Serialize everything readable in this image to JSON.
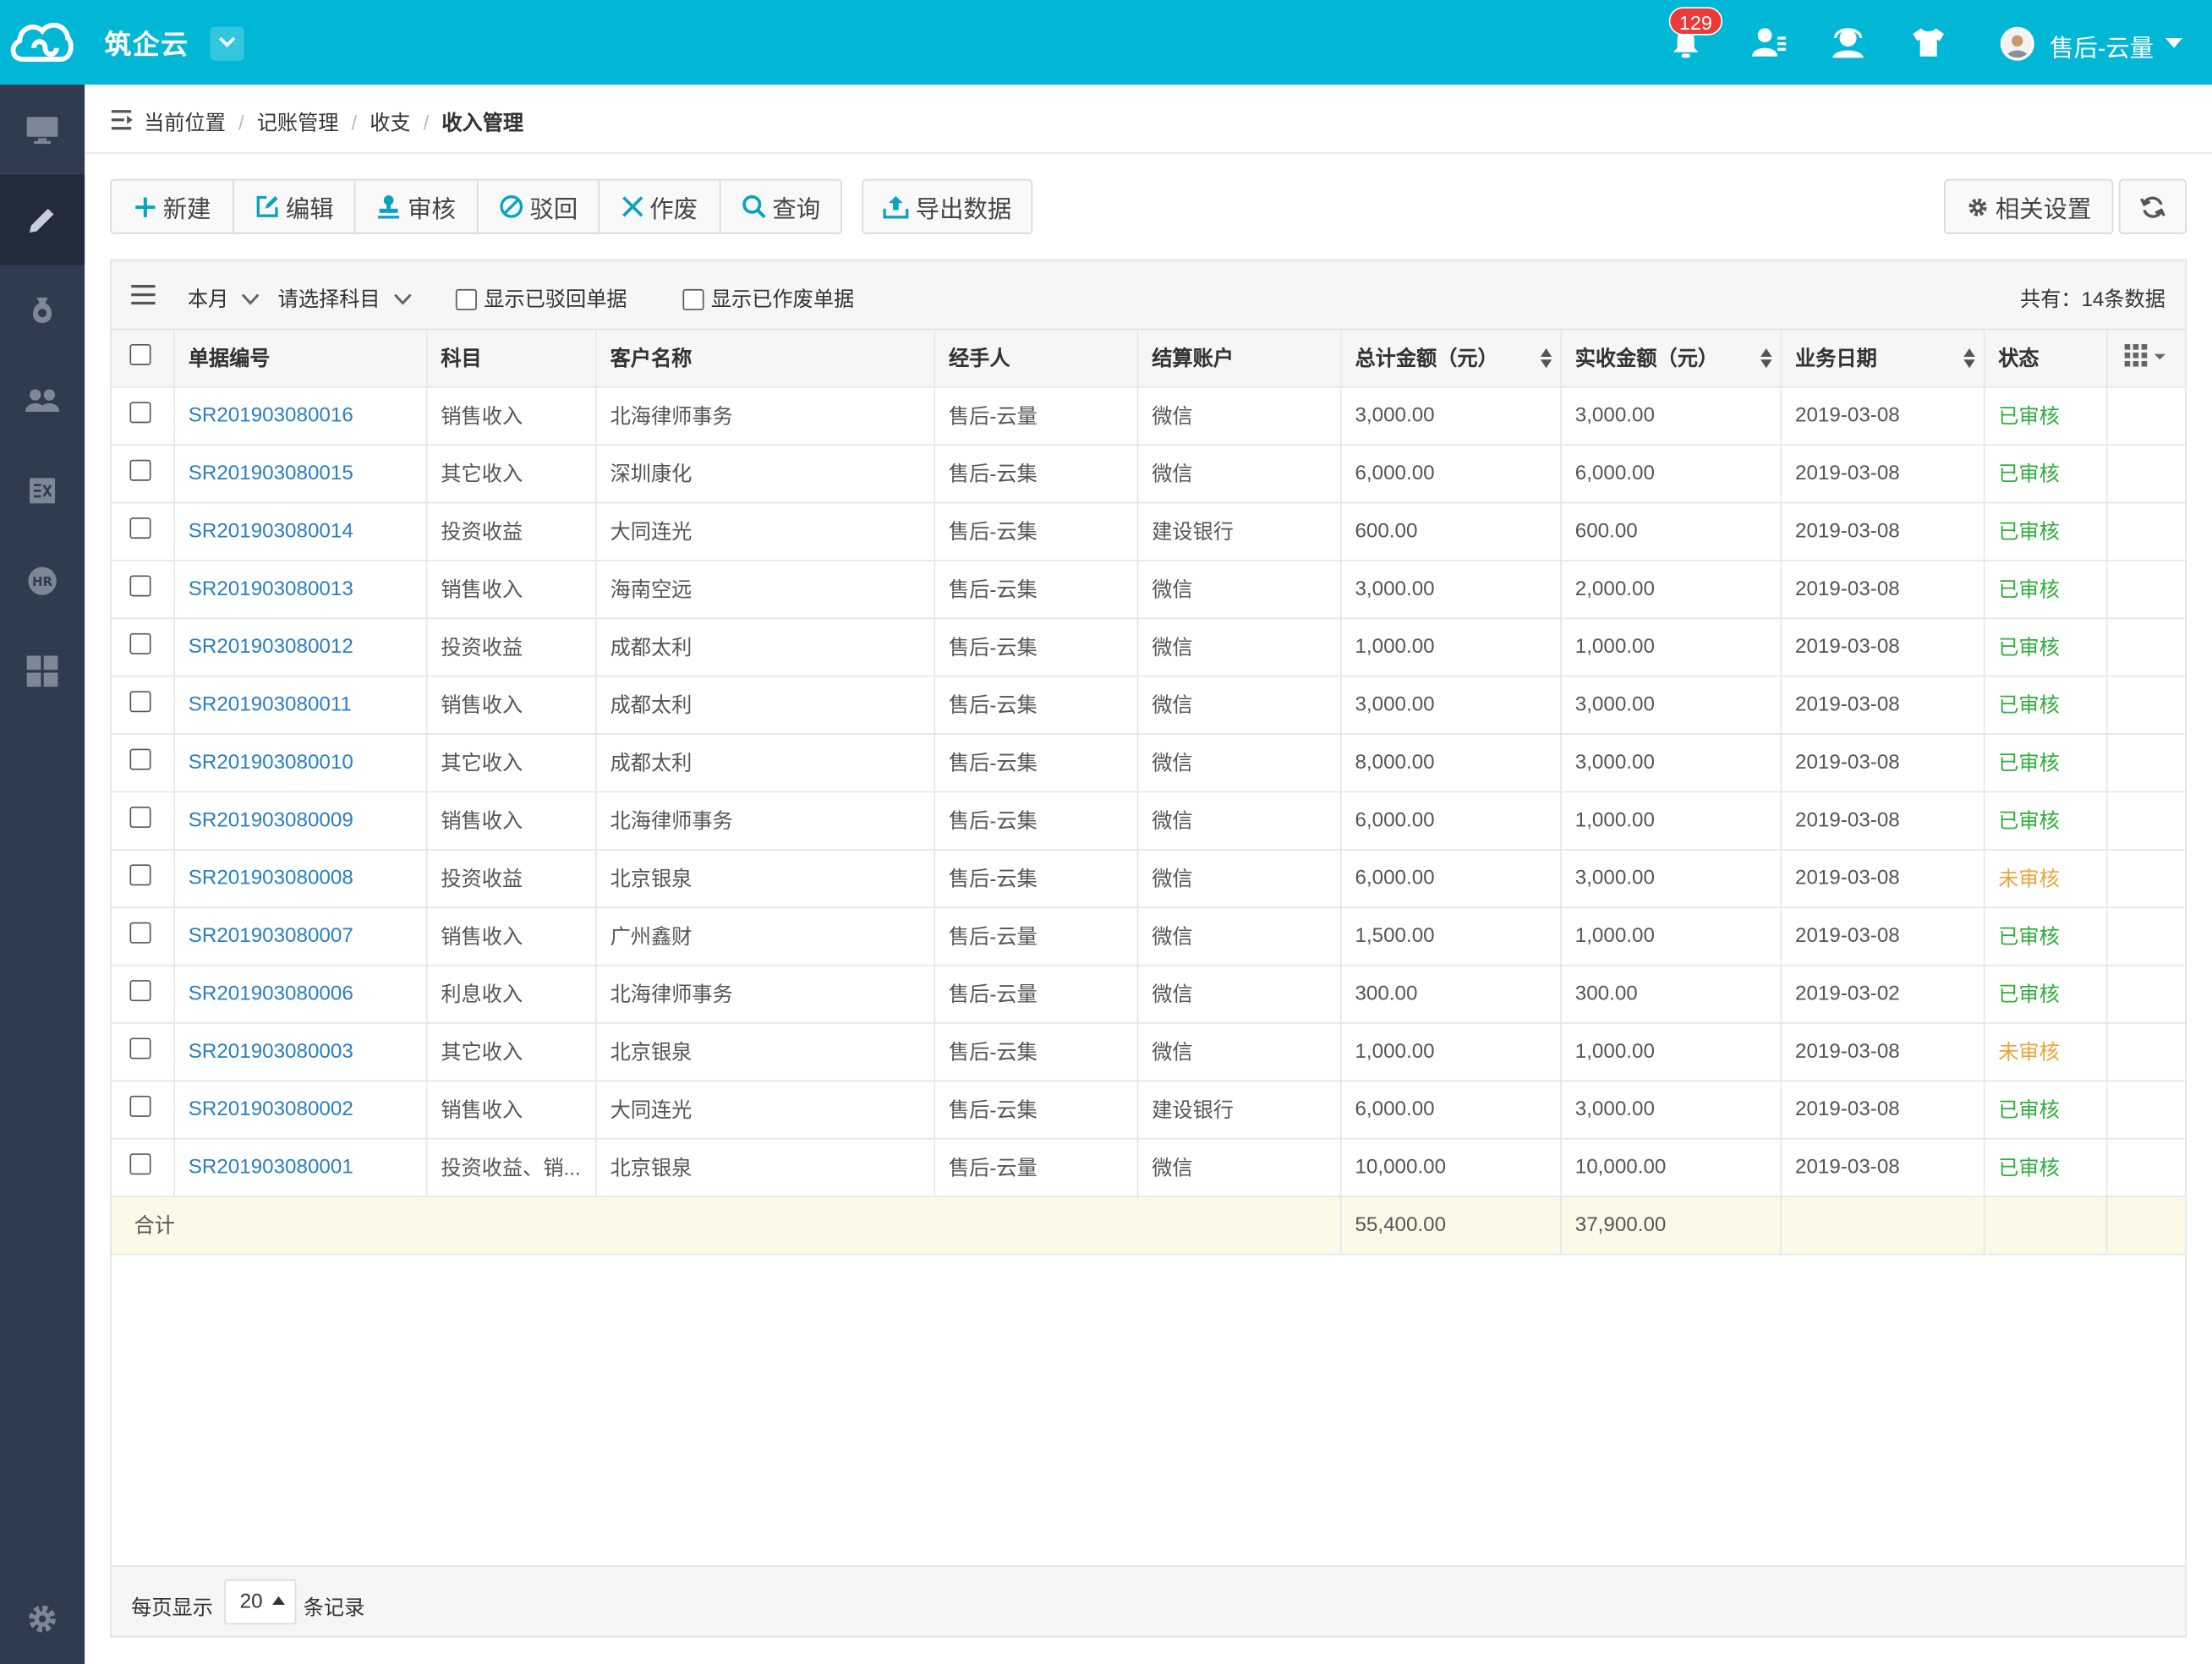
{
  "app": {
    "name": "筑企云"
  },
  "header": {
    "notification_count": "129",
    "user_name": "售后-云量"
  },
  "breadcrumb": {
    "items": [
      "当前位置",
      "记账管理",
      "收支",
      "收入管理"
    ]
  },
  "toolbar": {
    "new_label": "新建",
    "edit_label": "编辑",
    "audit_label": "审核",
    "reject_label": "驳回",
    "void_label": "作废",
    "query_label": "查询",
    "export_label": "导出数据",
    "settings_label": "相关设置"
  },
  "filters": {
    "period": "本月",
    "subject_placeholder": "请选择科目",
    "show_rejected": "显示已驳回单据",
    "show_voided": "显示已作废单据",
    "total_count": "共有：14条数据"
  },
  "table": {
    "columns": [
      "单据编号",
      "科目",
      "客户名称",
      "经手人",
      "结算账户",
      "总计金额（元）",
      "实收金额（元）",
      "业务日期",
      "状态"
    ],
    "rows": [
      [
        "SR201903080016",
        "销售收入",
        "北海律师事务",
        "售后-云量",
        "微信",
        "3,000.00",
        "3,000.00",
        "2019-03-08",
        "已审核"
      ],
      [
        "SR201903080015",
        "其它收入",
        "深圳康化",
        "售后-云集",
        "微信",
        "6,000.00",
        "6,000.00",
        "2019-03-08",
        "已审核"
      ],
      [
        "SR201903080014",
        "投资收益",
        "大同连光",
        "售后-云集",
        "建设银行",
        "600.00",
        "600.00",
        "2019-03-08",
        "已审核"
      ],
      [
        "SR201903080013",
        "销售收入",
        "海南空远",
        "售后-云集",
        "微信",
        "3,000.00",
        "2,000.00",
        "2019-03-08",
        "已审核"
      ],
      [
        "SR201903080012",
        "投资收益",
        "成都太利",
        "售后-云集",
        "微信",
        "1,000.00",
        "1,000.00",
        "2019-03-08",
        "已审核"
      ],
      [
        "SR201903080011",
        "销售收入",
        "成都太利",
        "售后-云集",
        "微信",
        "3,000.00",
        "3,000.00",
        "2019-03-08",
        "已审核"
      ],
      [
        "SR201903080010",
        "其它收入",
        "成都太利",
        "售后-云集",
        "微信",
        "8,000.00",
        "3,000.00",
        "2019-03-08",
        "已审核"
      ],
      [
        "SR201903080009",
        "销售收入",
        "北海律师事务",
        "售后-云集",
        "微信",
        "6,000.00",
        "1,000.00",
        "2019-03-08",
        "已审核"
      ],
      [
        "SR201903080008",
        "投资收益",
        "北京银泉",
        "售后-云集",
        "微信",
        "6,000.00",
        "3,000.00",
        "2019-03-08",
        "未审核"
      ],
      [
        "SR201903080007",
        "销售收入",
        "广州鑫财",
        "售后-云量",
        "微信",
        "1,500.00",
        "1,000.00",
        "2019-03-08",
        "已审核"
      ],
      [
        "SR201903080006",
        "利息收入",
        "北海律师事务",
        "售后-云量",
        "微信",
        "300.00",
        "300.00",
        "2019-03-02",
        "已审核"
      ],
      [
        "SR201903080003",
        "其它收入",
        "北京银泉",
        "售后-云集",
        "微信",
        "1,000.00",
        "1,000.00",
        "2019-03-08",
        "未审核"
      ],
      [
        "SR201903080002",
        "销售收入",
        "大同连光",
        "售后-云集",
        "建设银行",
        "6,000.00",
        "3,000.00",
        "2019-03-08",
        "已审核"
      ],
      [
        "SR201903080001",
        "投资收益、销...",
        "北京银泉",
        "售后-云量",
        "微信",
        "10,000.00",
        "10,000.00",
        "2019-03-08",
        "已审核"
      ]
    ],
    "total": {
      "label": "合计",
      "total_amount": "55,400.00",
      "received_amount": "37,900.00"
    }
  },
  "pagination": {
    "per_page_label": "每页显示",
    "per_page_value": "20",
    "records_label": "条记录"
  },
  "colors": {
    "topbar": "#00b7d6",
    "sidebar": "#2f3b4e",
    "approved": "#2eae3a",
    "pending": "#f0a23c",
    "link": "#2a7fc1"
  }
}
